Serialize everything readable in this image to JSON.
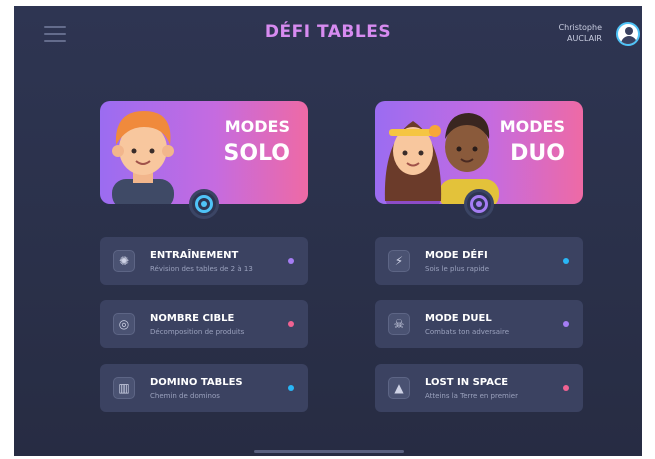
{
  "header": {
    "title": "DÉFI TABLES",
    "user_first": "Christophe",
    "user_last": "AUCLAIR",
    "icons": {
      "menu": "hamburger-menu-icon",
      "profile": "user-avatar-icon"
    }
  },
  "modes": [
    {
      "line1": "MODES",
      "line2": "SOLO"
    },
    {
      "line1": "MODES",
      "line2": "DUO"
    }
  ],
  "items": [
    {
      "title": "ENTRAÎNEMENT",
      "sub": "Révision des tables de 2 à 13",
      "icon": "lightbulb-icon",
      "glyph": "✺",
      "dot": "#a57df3"
    },
    {
      "title": "MODE DÉFI",
      "sub": "Sois le plus rapide",
      "icon": "lightning-icon",
      "glyph": "⚡",
      "dot": "#29b6f6"
    },
    {
      "title": "NOMBRE CIBLE",
      "sub": "Décomposition de produits",
      "icon": "target-icon",
      "glyph": "◎",
      "dot": "#f06292"
    },
    {
      "title": "MODE DUEL",
      "sub": "Combats ton adversaire",
      "icon": "skull-icon",
      "glyph": "☠",
      "dot": "#a57df3"
    },
    {
      "title": "DOMINO TABLES",
      "sub": "Chemin de dominos",
      "icon": "domino-icon",
      "glyph": "▥",
      "dot": "#29b6f6"
    },
    {
      "title": "LOST IN SPACE",
      "sub": "Atteins la Terre en premier",
      "icon": "rocket-icon",
      "glyph": "▲",
      "dot": "#f06292"
    }
  ],
  "colors": {
    "accent": "#d78bf0",
    "background": "#2a3049",
    "card": "#3b4261",
    "ring": "#4fc3f7"
  }
}
